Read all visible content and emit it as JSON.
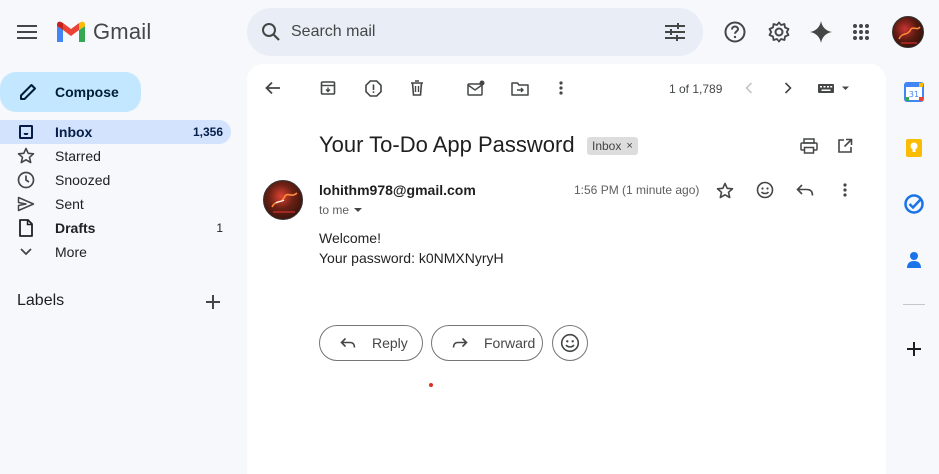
{
  "header": {
    "app_name": "Gmail",
    "search_placeholder": "Search mail"
  },
  "sidebar": {
    "compose_label": "Compose",
    "items": [
      {
        "label": "Inbox",
        "count": "1,356",
        "icon": "inbox-icon"
      },
      {
        "label": "Starred",
        "count": "",
        "icon": "star-icon"
      },
      {
        "label": "Snoozed",
        "count": "",
        "icon": "clock-icon"
      },
      {
        "label": "Sent",
        "count": "",
        "icon": "send-icon"
      },
      {
        "label": "Drafts",
        "count": "1",
        "icon": "draft-icon"
      },
      {
        "label": "More",
        "count": "",
        "icon": "chevron-down-icon"
      }
    ],
    "labels_heading": "Labels"
  },
  "toolbar": {
    "counter": "1 of 1,789"
  },
  "email": {
    "subject": "Your To-Do App Password",
    "label_chip": "Inbox",
    "label_chip_close": "×",
    "sender": "lohithm978@gmail.com",
    "to": "to me",
    "time": "1:56 PM (1 minute ago)",
    "body_line1": "Welcome!",
    "body_line2": "Your password: k0NMXNyryH"
  },
  "actions": {
    "reply_label": "Reply",
    "forward_label": "Forward"
  },
  "colors": {
    "accent": "#0b57d0",
    "compose_bg": "#c2e7ff",
    "active_nav_bg": "#d3e3fd",
    "search_bg": "#e9eef6"
  }
}
